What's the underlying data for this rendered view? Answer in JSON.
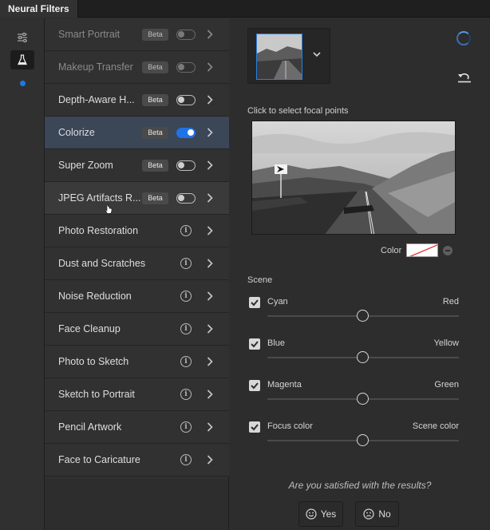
{
  "window": {
    "title": "Neural Filters"
  },
  "rail": {
    "icons": [
      "sliders-icon",
      "flask-icon"
    ],
    "active_index": 1,
    "accent_color": "#1e78e6"
  },
  "filters": [
    {
      "label": "Smart Portrait",
      "badge": "Beta",
      "toggle": "off",
      "disabled": true
    },
    {
      "label": "Makeup Transfer",
      "badge": "Beta",
      "toggle": "off",
      "disabled": true
    },
    {
      "label": "Depth-Aware H...",
      "badge": "Beta",
      "toggle": "off",
      "disabled": false
    },
    {
      "label": "Colorize",
      "badge": "Beta",
      "toggle": "on",
      "disabled": false,
      "selected": true
    },
    {
      "label": "Super Zoom",
      "badge": "Beta",
      "toggle": "off",
      "disabled": false
    },
    {
      "label": "JPEG Artifacts R...",
      "badge": "Beta",
      "toggle": "off",
      "disabled": false,
      "hover": true
    },
    {
      "label": "Photo Restoration",
      "info": true
    },
    {
      "label": "Dust and Scratches",
      "info": true
    },
    {
      "label": "Noise Reduction",
      "info": true
    },
    {
      "label": "Face Cleanup",
      "info": true
    },
    {
      "label": "Photo to Sketch",
      "info": true
    },
    {
      "label": "Sketch to Portrait",
      "info": true
    },
    {
      "label": "Pencil Artwork",
      "info": true
    },
    {
      "label": "Face to Caricature",
      "info": true
    }
  ],
  "panel": {
    "focal_label": "Click to select focal points",
    "color_label": "Color",
    "scene_label": "Scene",
    "sliders": [
      {
        "left": "Cyan",
        "right": "Red",
        "checked": true,
        "value": 0.5
      },
      {
        "left": "Blue",
        "right": "Yellow",
        "checked": true,
        "value": 0.5
      },
      {
        "left": "Magenta",
        "right": "Green",
        "checked": true,
        "value": 0.5
      },
      {
        "left": "Focus color",
        "right": "Scene color",
        "checked": true,
        "value": 0.5
      }
    ],
    "feedback": {
      "question": "Are you satisfied with the results?",
      "yes": "Yes",
      "no": "No"
    }
  },
  "colors": {
    "toggle_on": "#1f73e8",
    "selected_row": "#3b4657",
    "thumb_border": "#2d7fe0"
  }
}
